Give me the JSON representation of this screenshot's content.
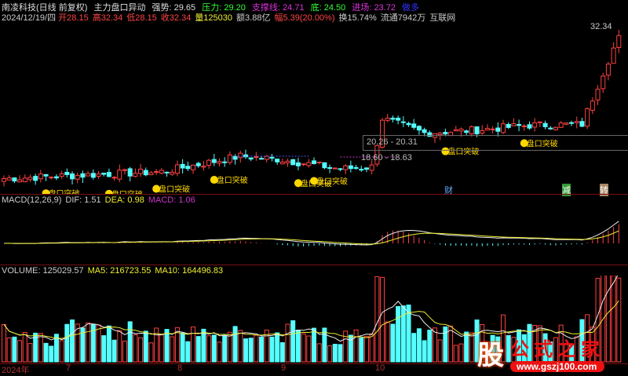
{
  "header": {
    "stock": "南凌科技(日线 前复权)",
    "indicator": "主力盘口异动",
    "strength": "强势: 29.65",
    "pressure": "压力: 29.20",
    "support": "支撑线: 24.71",
    "bottom": "底: 24.50",
    "entry": "进场: 23.72",
    "extra": "做多"
  },
  "quote": {
    "date": "2024/12/19/四",
    "open": "开28.15",
    "high": "高32.34",
    "low": "低28.15",
    "close": "收32.34",
    "volume": "量125030",
    "amount": "额3.88亿",
    "change": "幅5.39(20.00%)",
    "turnover": "换15.74%",
    "float": "流通7942万",
    "sector": "互联网"
  },
  "price": {
    "max_label": "32.34",
    "range1": "20.26 - 20.31",
    "range2": "18.60 - 18.63",
    "signal": "盘口突破",
    "markers": [
      "财",
      "减",
      "转"
    ]
  },
  "macd": {
    "title": "MACD(12,26,9)",
    "dif": "DIF: 1.51",
    "dea": "DEA: 0.98",
    "macd": "MACD: 1.06"
  },
  "volume": {
    "title": "VOLUME: 125029.57",
    "ma5": "MA5: 216723.55",
    "ma10": "MA10: 164496.83"
  },
  "xaxis": [
    "2024年",
    "7",
    "8",
    "9",
    "10"
  ],
  "logo": {
    "char": "股",
    "name": "公式之家",
    "url": "www.gszj100.com"
  },
  "chart_data": {
    "type": "candlestick",
    "keypoints": [
      [
        0,
        17.6
      ],
      [
        30,
        18.3
      ],
      [
        45,
        19.9
      ],
      [
        52,
        19.6
      ],
      [
        64,
        18.6
      ],
      [
        70,
        18.8
      ],
      [
        72,
        23.8
      ],
      [
        80,
        22.3
      ],
      [
        90,
        22.6
      ],
      [
        100,
        23.1
      ],
      [
        110,
        23.2
      ],
      [
        114,
        28.5
      ],
      [
        117,
        32.34
      ]
    ],
    "count": 118,
    "ymin": 16.5,
    "ymax": 33.5
  },
  "colors": {
    "up": "#ff4040",
    "down": "#54ffff",
    "signal": "#ffd700"
  }
}
